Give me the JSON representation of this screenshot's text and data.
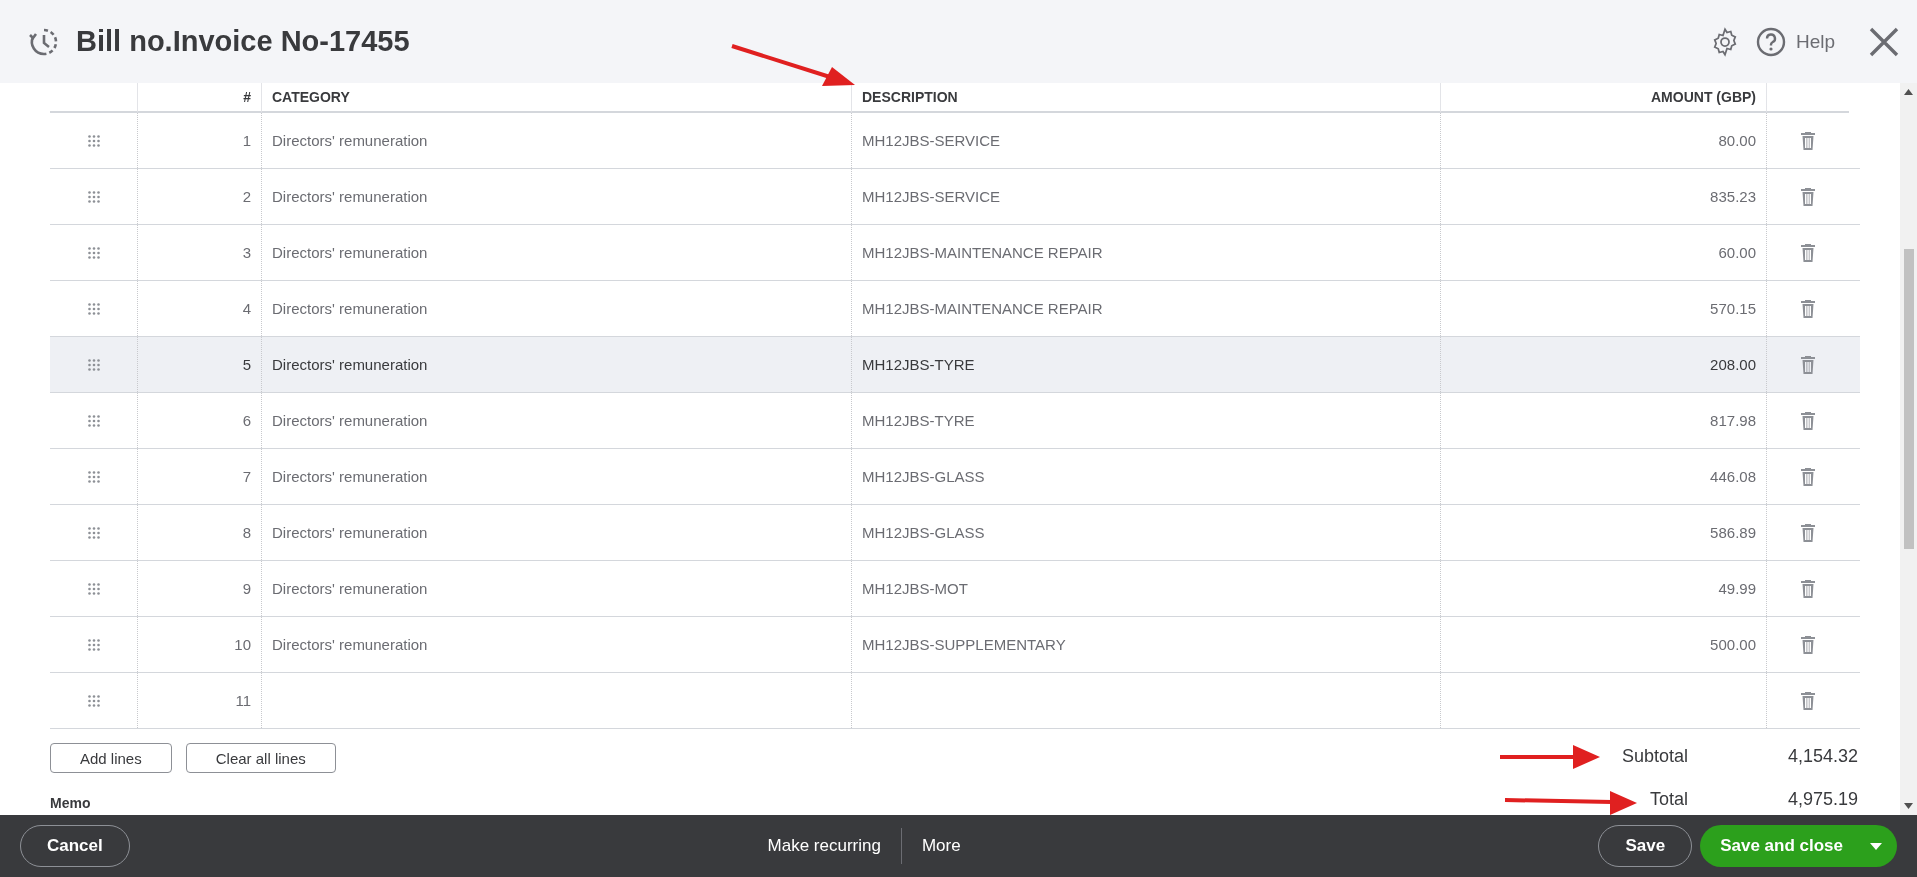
{
  "header": {
    "title": "Bill no.Invoice No-17455",
    "help": "Help"
  },
  "table": {
    "columns": [
      "#",
      "CATEGORY",
      "DESCRIPTION",
      "AMOUNT (GBP)"
    ],
    "rows": [
      {
        "num": "1",
        "category": "Directors' remuneration",
        "description": "MH12JBS-SERVICE",
        "amount": "80.00",
        "highlighted": false
      },
      {
        "num": "2",
        "category": "Directors' remuneration",
        "description": "MH12JBS-SERVICE",
        "amount": "835.23",
        "highlighted": false
      },
      {
        "num": "3",
        "category": "Directors' remuneration",
        "description": "MH12JBS-MAINTENANCE REPAIR",
        "amount": "60.00",
        "highlighted": false
      },
      {
        "num": "4",
        "category": "Directors' remuneration",
        "description": "MH12JBS-MAINTENANCE REPAIR",
        "amount": "570.15",
        "highlighted": false
      },
      {
        "num": "5",
        "category": "Directors' remuneration",
        "description": "MH12JBS-TYRE",
        "amount": "208.00",
        "highlighted": true
      },
      {
        "num": "6",
        "category": "Directors' remuneration",
        "description": "MH12JBS-TYRE",
        "amount": "817.98",
        "highlighted": false
      },
      {
        "num": "7",
        "category": "Directors' remuneration",
        "description": "MH12JBS-GLASS",
        "amount": "446.08",
        "highlighted": false
      },
      {
        "num": "8",
        "category": "Directors' remuneration",
        "description": "MH12JBS-GLASS",
        "amount": "586.89",
        "highlighted": false
      },
      {
        "num": "9",
        "category": "Directors' remuneration",
        "description": "MH12JBS-MOT",
        "amount": "49.99",
        "highlighted": false
      },
      {
        "num": "10",
        "category": "Directors' remuneration",
        "description": "MH12JBS-SUPPLEMENTARY",
        "amount": "500.00",
        "highlighted": false
      },
      {
        "num": "11",
        "highlighted": false
      }
    ]
  },
  "line_buttons": [
    "Add lines",
    "Clear all lines"
  ],
  "memo_label": "Memo",
  "totals": [
    {
      "label": "Subtotal",
      "value": "4,154.32"
    },
    {
      "label": "Total",
      "value": "4,975.19"
    }
  ],
  "footer": {
    "cancel": "Cancel",
    "make_recurring": "Make recurring",
    "more": "More",
    "save": "Save",
    "save_and_close": "Save and close"
  }
}
